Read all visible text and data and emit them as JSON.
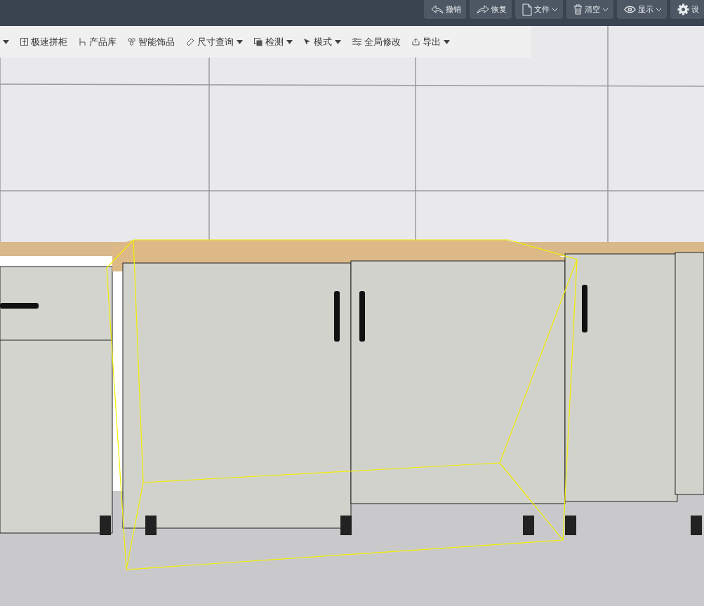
{
  "top_bar": {
    "buttons": [
      {
        "label": "撤销",
        "dropdown": false
      },
      {
        "label": "恢复",
        "dropdown": false
      },
      {
        "label": "文件",
        "dropdown": true
      },
      {
        "label": "清空",
        "dropdown": true
      },
      {
        "label": "显示",
        "dropdown": true
      },
      {
        "label": "设",
        "dropdown": false
      }
    ]
  },
  "toolbar": {
    "leading_dropdown": true,
    "items": [
      {
        "label": "极速拼柜",
        "dropdown": false
      },
      {
        "label": "产品库",
        "dropdown": false
      },
      {
        "label": "智能饰品",
        "dropdown": false
      },
      {
        "label": "尺寸查询",
        "dropdown": true
      },
      {
        "label": "检测",
        "dropdown": true
      },
      {
        "label": "模式",
        "dropdown": true
      },
      {
        "label": "全局修改",
        "dropdown": false
      },
      {
        "label": "导出",
        "dropdown": true
      }
    ]
  }
}
